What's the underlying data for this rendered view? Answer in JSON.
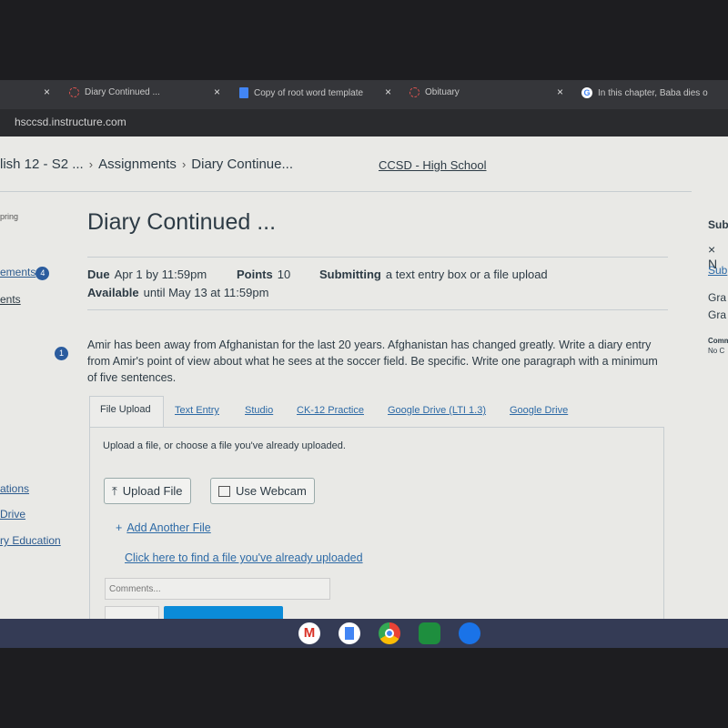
{
  "browser": {
    "tabs": [
      {
        "label": "Diary Continued ...",
        "icon": "canvas-icon"
      },
      {
        "label": "Copy of root word template",
        "icon": "google-docs-icon"
      },
      {
        "label": "Obituary",
        "icon": "canvas-icon"
      },
      {
        "label": "In this chapter, Baba dies o",
        "icon": "google-icon"
      }
    ],
    "url": "hsccsd.instructure.com"
  },
  "breadcrumb": [
    "lish 12 - S2 ...",
    "Assignments",
    "Diary Continue..."
  ],
  "school_link": "CCSD - High School",
  "sidebar": {
    "items": [
      {
        "label": "pring"
      },
      {
        "label": "ements",
        "badge": "4"
      },
      {
        "label": "ents"
      },
      {
        "label": "ations"
      },
      {
        "label": "Drive"
      },
      {
        "label": "ry Education"
      }
    ]
  },
  "assignment": {
    "title": "Diary Continued ...",
    "due_label": "Due",
    "due": "Apr 1 by 11:59pm",
    "points_label": "Points",
    "points": "10",
    "submitting_label": "Submitting",
    "submitting": "a text entry box or a file upload",
    "available_label": "Available",
    "available": "until May 13 at 11:59pm",
    "step_badge": "1",
    "description": "Amir has been away from Afghanistan for the last 20 years.  Afghanistan has changed greatly.  Write a diary entry from Amir's point of view about what he sees at the soccer field.  Be specific.  Write one paragraph with a minimum of five sentences."
  },
  "submission": {
    "tabs": [
      "File Upload",
      "Text Entry",
      "Studio",
      "CK-12 Practice",
      "Google Drive (LTI 1.3)",
      "Google Drive"
    ],
    "instructions": "Upload a file, or choose a file you've already uploaded.",
    "upload_button": "Upload File",
    "webcam_button": "Use Webcam",
    "add_file": "Add Another File",
    "find_file": "Click here to find a file you've already uploaded",
    "comments_placeholder": "Comments..."
  },
  "right_panel": [
    "Sub",
    "× N",
    "Sub",
    "Gra",
    "Gra",
    "Comm",
    "No C"
  ],
  "shelf": [
    "gmail-icon",
    "google-docs-icon",
    "chrome-icon",
    "calculator-icon",
    "files-icon"
  ],
  "colors": {
    "link": "#2d6aa6",
    "badge": "#2b5c9e",
    "primary_button": "#0b8bd8"
  }
}
